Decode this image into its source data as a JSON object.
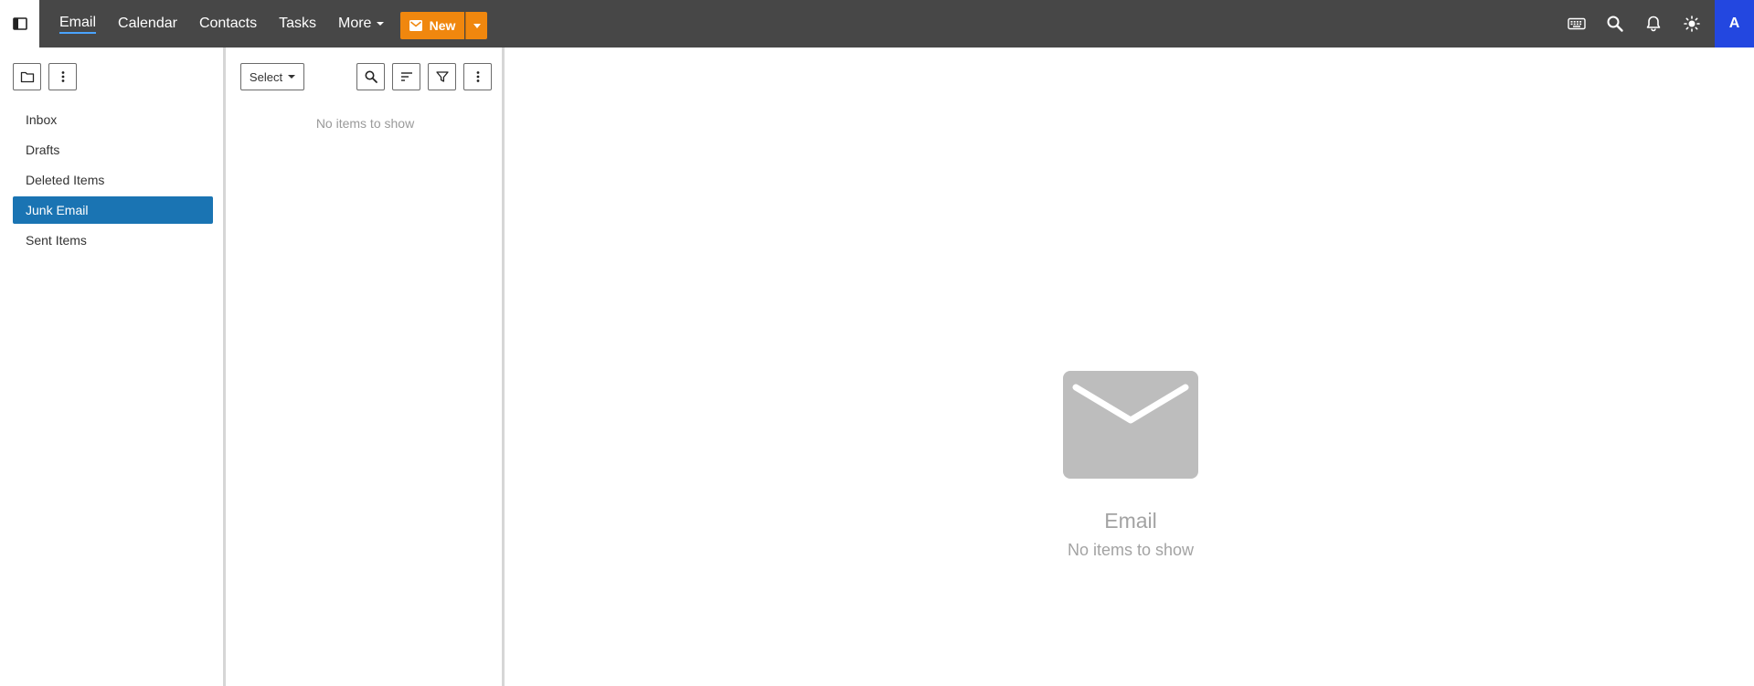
{
  "topbar": {
    "nav": [
      {
        "label": "Email",
        "active": true
      },
      {
        "label": "Calendar",
        "active": false
      },
      {
        "label": "Contacts",
        "active": false
      },
      {
        "label": "Tasks",
        "active": false
      },
      {
        "label": "More",
        "active": false
      }
    ],
    "new_label": "New",
    "avatar_letter": "A",
    "icons": [
      "sidebar-toggle-icon",
      "keyboard-icon",
      "search-icon",
      "bell-icon",
      "sun-icon"
    ]
  },
  "folders": {
    "items": [
      {
        "label": "Inbox",
        "selected": false
      },
      {
        "label": "Drafts",
        "selected": false
      },
      {
        "label": "Deleted Items",
        "selected": false
      },
      {
        "label": "Junk Email",
        "selected": true
      },
      {
        "label": "Sent Items",
        "selected": false
      }
    ]
  },
  "list": {
    "select_label": "Select",
    "empty_text": "No items to show"
  },
  "reading": {
    "empty_title": "Email",
    "empty_sub": "No items to show"
  },
  "colors": {
    "topbar": "#474747",
    "accent_new": "#f0870e",
    "selected_folder": "#1a74b3",
    "avatar": "#2347e0"
  }
}
